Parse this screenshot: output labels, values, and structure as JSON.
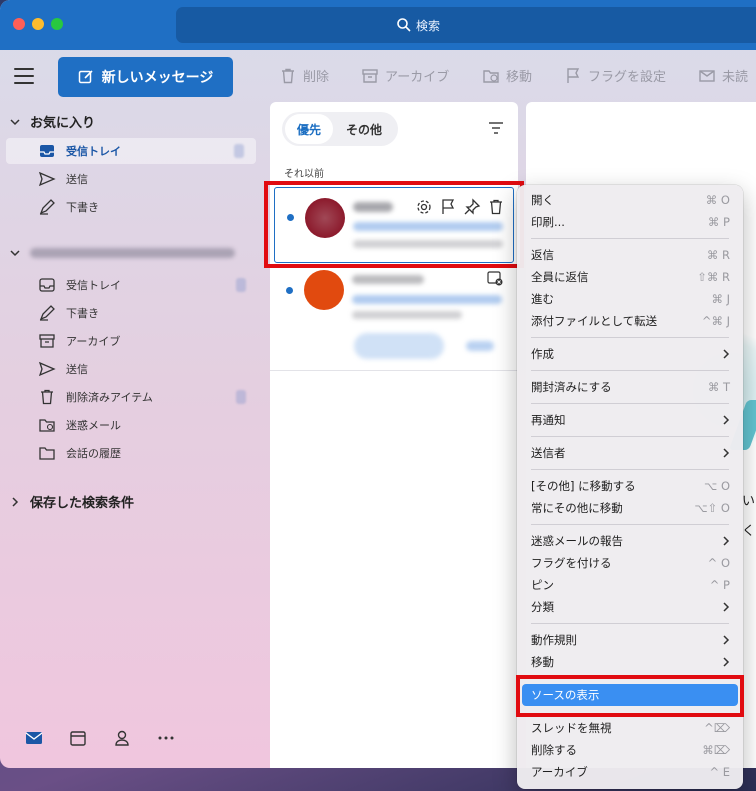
{
  "search": {
    "label": "検索"
  },
  "toolbar": {
    "new_message": "新しいメッセージ",
    "delete": "削除",
    "archive": "アーカイブ",
    "move": "移動",
    "flag": "フラグを設定",
    "unread": "未読"
  },
  "sidebar": {
    "favorites_title": "お気に入り",
    "favorites": [
      {
        "label": "受信トレイ",
        "icon": "inbox-icon"
      },
      {
        "label": "送信",
        "icon": "send-icon"
      },
      {
        "label": "下書き",
        "icon": "draft-icon"
      }
    ],
    "account_items": [
      {
        "label": "受信トレイ",
        "icon": "inbox-icon"
      },
      {
        "label": "下書き",
        "icon": "draft-icon"
      },
      {
        "label": "アーカイブ",
        "icon": "archive-icon"
      },
      {
        "label": "送信",
        "icon": "send-icon"
      },
      {
        "label": "削除済みアイテム",
        "icon": "trash-icon"
      },
      {
        "label": "迷惑メール",
        "icon": "junk-icon"
      },
      {
        "label": "会話の履歴",
        "icon": "folder-icon"
      }
    ],
    "saved_searches_title": "保存した検索条件"
  },
  "message_list": {
    "tab_focused": "優先",
    "tab_other": "その他",
    "group_label": "それ以前"
  },
  "reading_pane": {
    "edge_text_1": "い",
    "edge_text_2": "く"
  },
  "context_menu": {
    "items": [
      {
        "label": "開く",
        "shortcut": "⌘ O"
      },
      {
        "label": "印刷...",
        "shortcut": "⌘ P"
      },
      {
        "label": "返信",
        "shortcut": "⌘ R"
      },
      {
        "label": "全員に返信",
        "shortcut": "⇧⌘ R"
      },
      {
        "label": "進む",
        "shortcut": "⌘ J"
      },
      {
        "label": "添付ファイルとして転送",
        "shortcut": "^⌘ J"
      },
      {
        "label": "作成",
        "shortcut": ""
      },
      {
        "label": "開封済みにする",
        "shortcut": "⌘ T"
      },
      {
        "label": "再通知",
        "shortcut": ""
      },
      {
        "label": "送信者",
        "shortcut": ""
      },
      {
        "label": "[その他] に移動する",
        "shortcut": "⌥ O"
      },
      {
        "label": "常にその他に移動",
        "shortcut": "⌥⇧ O"
      },
      {
        "label": "迷惑メールの報告",
        "shortcut": ""
      },
      {
        "label": "フラグを付ける",
        "shortcut": "^ O"
      },
      {
        "label": "ピン",
        "shortcut": "^ P"
      },
      {
        "label": "分類",
        "shortcut": ""
      },
      {
        "label": "動作規則",
        "shortcut": ""
      },
      {
        "label": "移動",
        "shortcut": ""
      },
      {
        "label": "ソースの表示",
        "shortcut": ""
      },
      {
        "label": "スレッドを無視",
        "shortcut": "^⌦"
      },
      {
        "label": "削除する",
        "shortcut": "⌘⌦"
      },
      {
        "label": "アーカイブ",
        "shortcut": "^ E"
      }
    ]
  },
  "colors": {
    "accent": "#1f6fc4",
    "menu_highlight": "#3a8ff2",
    "annotation_red": "#e10b10"
  }
}
